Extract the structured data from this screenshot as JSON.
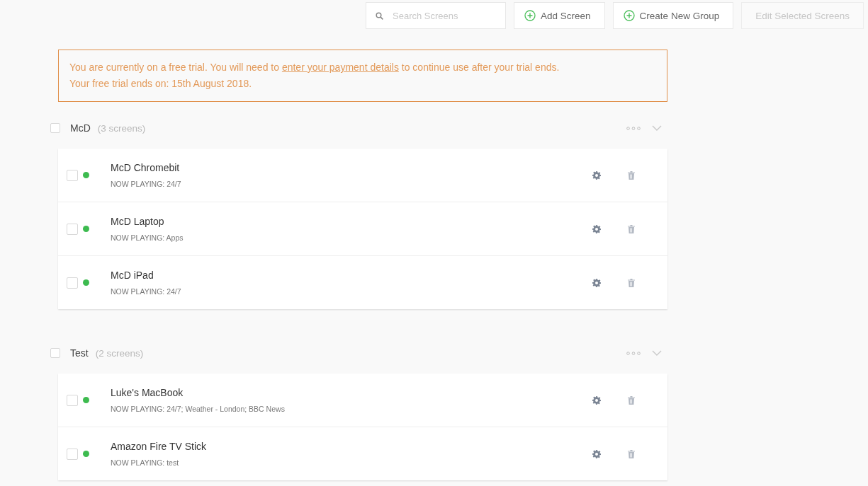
{
  "toolbar": {
    "search": {
      "placeholder": "Search Screens"
    },
    "buttons": [
      {
        "label": "Add Screen",
        "kind": "add",
        "disabled": false
      },
      {
        "label": "Create New Group",
        "kind": "add",
        "disabled": false
      },
      {
        "label": "Edit Selected Screens",
        "kind": "plain",
        "disabled": true
      }
    ]
  },
  "trial_notice": {
    "before": "You are currently on a free trial. You will need to ",
    "link": "enter your payment details",
    "after": " to continue use after your trial ends.",
    "line_2": "Your free trial ends on: 15th August 2018."
  },
  "groups": [
    {
      "name": "McD",
      "count": "(3 screens)",
      "checked": false,
      "screens": [
        {
          "name": "McD Chromebit",
          "now_playing": "NOW PLAYING: 24/7",
          "checked": false,
          "color": "#3dbb4f"
        },
        {
          "name": "McD Laptop",
          "now_playing": "NOW PLAYING: Apps",
          "checked": false,
          "color": "#3dbb4f"
        },
        {
          "name": "McD iPad",
          "now_playing": "NOW PLAYING: 24/7",
          "checked": false,
          "color": "#3dbb4f"
        }
      ]
    },
    {
      "name": "Test",
      "count": "(2 screens)",
      "checked": false,
      "screens": [
        {
          "name": "Luke's MacBook",
          "now_playing": "NOW PLAYING: 24/7; Weather - London; BBC News",
          "checked": false,
          "color": "#3dbb4f"
        },
        {
          "name": "Amazon Fire TV Stick",
          "now_playing": "NOW PLAYING: test",
          "checked": false,
          "color": "#3dbb4f"
        }
      ]
    }
  ]
}
